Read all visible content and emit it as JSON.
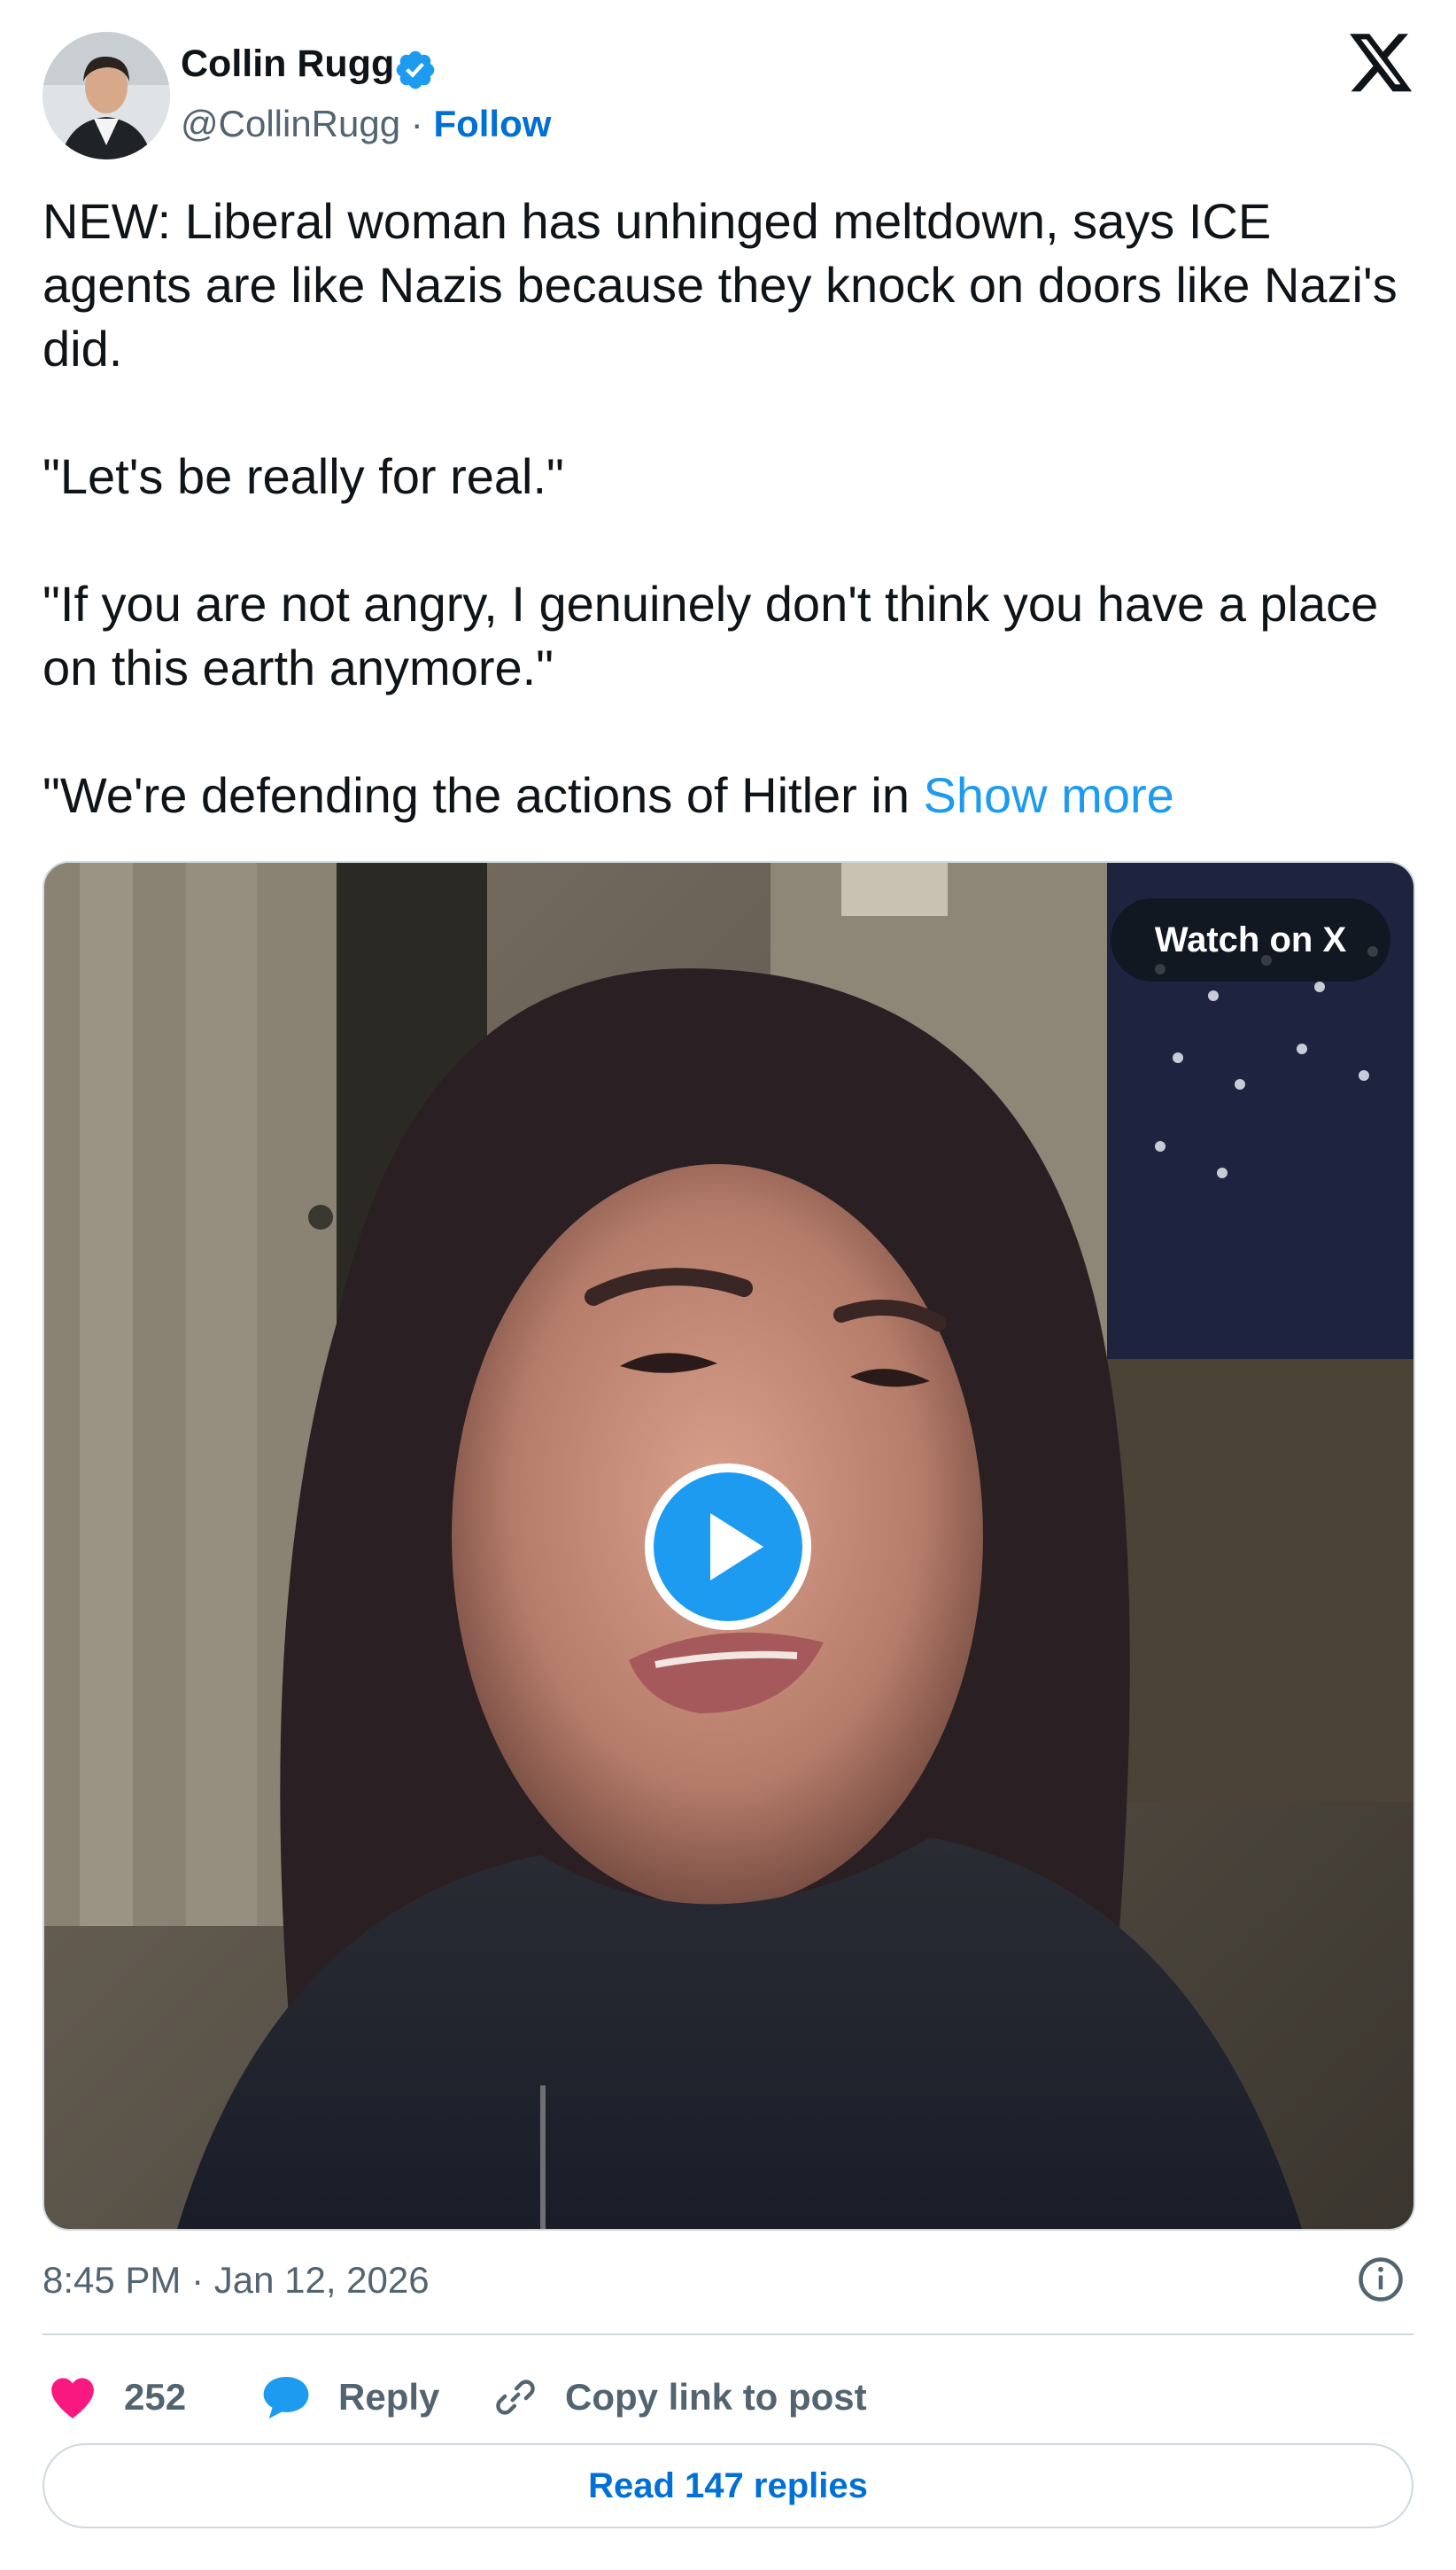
{
  "author": {
    "name": "Collin Rugg",
    "handle": "@CollinRugg",
    "separator": "·",
    "follow_label": "Follow",
    "verified": true
  },
  "brand_icon": "x-logo-icon",
  "post": {
    "paragraphs": [
      "NEW: Liberal woman has unhinged meltdown, says ICE agents are like Nazis because they knock on doors like Nazi's did.",
      "\"Let's be really for real.\"",
      "\"If you are not angry, I genuinely don't think you have a place on this earth anymore.\"",
      "\"We're defending the actions of Hitler in "
    ],
    "show_more_label": "Show more"
  },
  "media": {
    "type": "video",
    "watch_label": "Watch on X",
    "play_icon": "play-icon"
  },
  "meta": {
    "timestamp": "8:45 PM · Jan 12, 2026",
    "info_icon": "info-icon"
  },
  "actions": {
    "like_count": "252",
    "reply_label": "Reply",
    "copy_link_label": "Copy link to post"
  },
  "read_replies_label": "Read 147 replies",
  "colors": {
    "accent": "#1d9bf0",
    "link_blue": "#006fd6",
    "like_pink": "#f91880",
    "text_primary": "#0f1419",
    "text_secondary": "#536471",
    "border": "#cfd9de"
  }
}
